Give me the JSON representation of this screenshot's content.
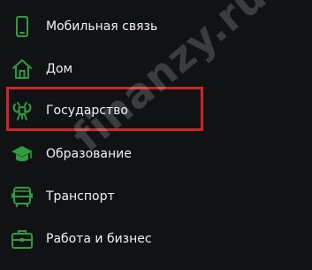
{
  "colors": {
    "background": "#111214",
    "icon_green": "#2f9d3f",
    "highlight_red": "#c8282d",
    "text": "#f1f1f1"
  },
  "menu": {
    "items": [
      {
        "label": "Мобильная связь",
        "icon": "mobile-phone-icon"
      },
      {
        "label": "Дом",
        "icon": "house-icon"
      },
      {
        "label": "Государство",
        "icon": "government-emblem-icon",
        "highlighted": true
      },
      {
        "label": "Образование",
        "icon": "graduation-cap-icon"
      },
      {
        "label": "Транспорт",
        "icon": "bus-icon"
      },
      {
        "label": "Работа и бизнес",
        "icon": "briefcase-icon"
      }
    ]
  },
  "watermark": {
    "text": "finanzy.ru"
  }
}
